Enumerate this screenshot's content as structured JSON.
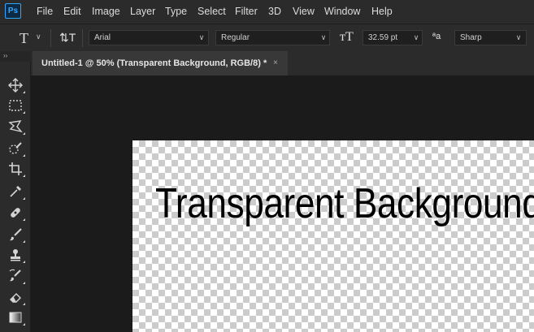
{
  "app": {
    "logo": "Ps"
  },
  "menu": [
    "File",
    "Edit",
    "Image",
    "Layer",
    "Type",
    "Select",
    "Filter",
    "3D",
    "View",
    "Window",
    "Help"
  ],
  "options": {
    "type_tool_glyph": "T",
    "orientation_glyph": "⇅T",
    "font_family": "Arial",
    "font_style": "Regular",
    "size_icon_glyph": "тT",
    "font_size": "32.59 pt",
    "antialias_icon_glyph": "ªa",
    "antialias": "Sharp"
  },
  "tabs": {
    "collapse_glyph": "››",
    "document_title": "Untitled-1 @ 50% (Transparent Background, RGB/8) *",
    "close_glyph": "×"
  },
  "tools": [
    "move-tool",
    "marquee-tool",
    "lasso-tool",
    "quick-selection-tool",
    "crop-tool",
    "eyedropper-tool",
    "healing-brush-tool",
    "brush-tool",
    "clone-stamp-tool",
    "history-brush-tool",
    "eraser-tool",
    "gradient-tool"
  ],
  "canvas": {
    "text": "Transparent Background"
  },
  "colors": {
    "ui_bg": "#2b2b2b",
    "panel_dark": "#1b1b1b",
    "accent": "#31a8ff"
  }
}
